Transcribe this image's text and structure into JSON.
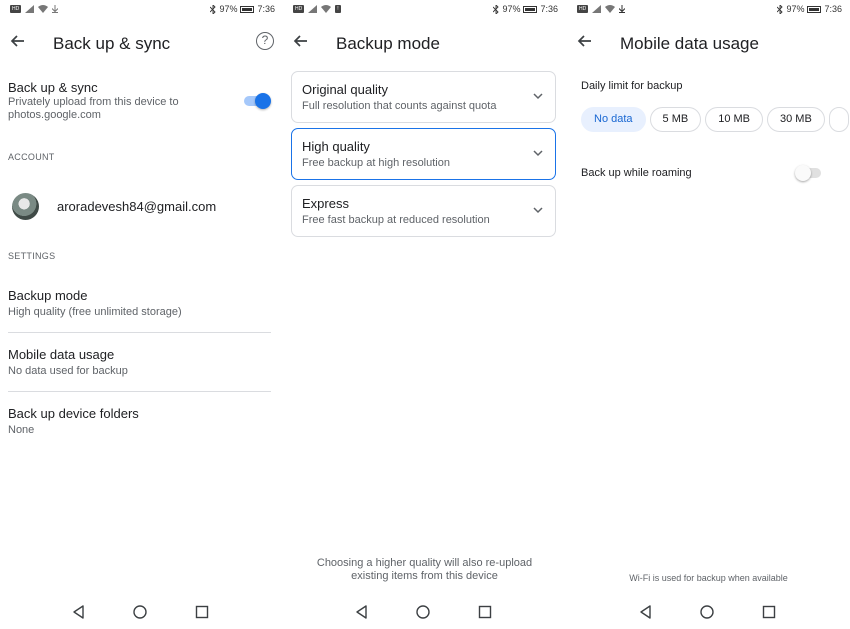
{
  "status": {
    "screens": [
      {
        "battery": "97%",
        "time": "7:36"
      },
      {
        "battery": "97%",
        "time": "7:36"
      },
      {
        "battery": "97%",
        "time": "7:36"
      }
    ]
  },
  "screen1": {
    "title": "Back up & sync",
    "sync": {
      "label": "Back up & sync",
      "description_line1": "Privately upload from this device to",
      "description_line2": "photos.google.com",
      "enabled": true
    },
    "account_header": "ACCOUNT",
    "account_email": "aroradevesh84@gmail.com",
    "settings_header": "SETTINGS",
    "items": [
      {
        "label": "Backup mode",
        "value": "High quality (free unlimited storage)"
      },
      {
        "label": "Mobile data usage",
        "value": "No data used for backup"
      },
      {
        "label": "Back up device folders",
        "value": "None"
      }
    ]
  },
  "screen2": {
    "title": "Backup mode",
    "options": [
      {
        "label": "Original quality",
        "description": "Full resolution that counts against quota",
        "selected": false
      },
      {
        "label": "High quality",
        "description": "Free backup at high resolution",
        "selected": true
      },
      {
        "label": "Express",
        "description": "Free fast backup at reduced resolution",
        "selected": false
      }
    ],
    "footnote_line1": "Choosing a higher quality will also re-upload",
    "footnote_line2": "existing items from this device"
  },
  "screen3": {
    "title": "Mobile data usage",
    "daily_limit_label": "Daily limit for backup",
    "chips": [
      {
        "label": "No data",
        "selected": true
      },
      {
        "label": "5 MB",
        "selected": false
      },
      {
        "label": "10 MB",
        "selected": false
      },
      {
        "label": "30 MB",
        "selected": false
      }
    ],
    "roaming_label": "Back up while roaming",
    "roaming_enabled": false,
    "footnote": "Wi-Fi is used for backup when available"
  },
  "colors": {
    "accent": "#1a73e8",
    "chip_active_bg": "#e8f0fe",
    "divider": "#dadce0",
    "secondary_text": "#5f6368"
  },
  "icons": [
    "back-arrow-icon",
    "help-icon",
    "chevron-down-icon",
    "nav-back-icon",
    "nav-home-icon",
    "nav-recents-icon",
    "wifi-icon",
    "signal-icon",
    "bluetooth-icon",
    "battery-icon",
    "download-icon"
  ]
}
